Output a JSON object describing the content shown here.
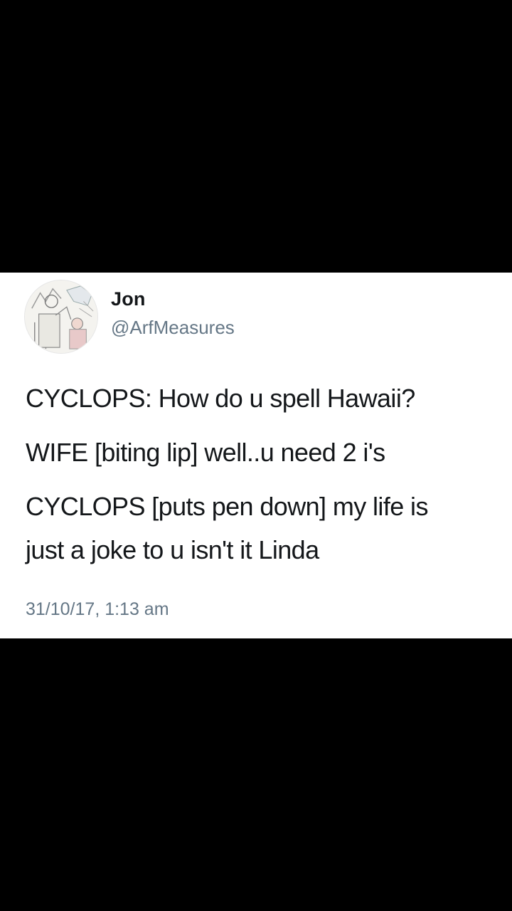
{
  "tweet": {
    "author": {
      "display_name": "Jon",
      "handle": "@ArfMeasures"
    },
    "text_lines": [
      "CYCLOPS: How do u spell Hawaii?",
      "WIFE [biting lip] well..u need 2 i's",
      "CYCLOPS [puts pen down] my life is",
      "just a joke to u isn't it Linda"
    ],
    "timestamp": "31/10/17, 1:13 am"
  },
  "colors": {
    "background": "#000000",
    "card": "#ffffff",
    "text_primary": "#14171a",
    "text_secondary": "#657786"
  },
  "icons": {
    "avatar": "sketch-illustration-avatar"
  }
}
